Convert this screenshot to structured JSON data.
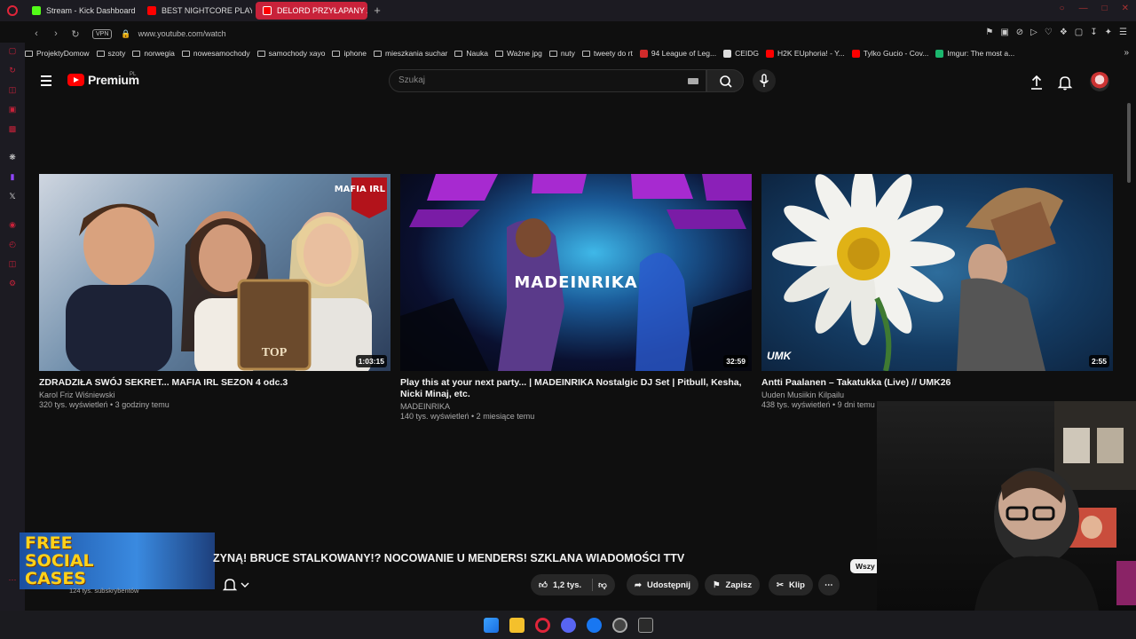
{
  "browser": {
    "tabs": [
      {
        "label": "Stream - Kick Dashboard",
        "favicon": "kick-icon",
        "active": false
      },
      {
        "label": "BEST NIGHTCORE PLAYLI",
        "favicon": "youtube-icon",
        "active": false
      },
      {
        "label": "DELORD PRZYŁAPANY Z",
        "favicon": "youtube-icon",
        "active": true
      }
    ],
    "new_tab": "+",
    "url": "www.youtube.com/watch",
    "vpn_label": "VPN",
    "accent_color": "#c8223a"
  },
  "bookmarks": [
    {
      "label": "ProjektyDomow",
      "type": "folder"
    },
    {
      "label": "szoty",
      "type": "folder"
    },
    {
      "label": "norwegia",
      "type": "folder"
    },
    {
      "label": "nowesamochody",
      "type": "folder"
    },
    {
      "label": "samochody xayo",
      "type": "folder"
    },
    {
      "label": "iphone",
      "type": "folder"
    },
    {
      "label": "mieszkania suchar",
      "type": "folder"
    },
    {
      "label": "Nauka",
      "type": "folder"
    },
    {
      "label": "Ważne jpg",
      "type": "folder"
    },
    {
      "label": "nuty",
      "type": "folder"
    },
    {
      "label": "tweety do rt",
      "type": "folder"
    },
    {
      "label": "94 League of Leg...",
      "type": "site",
      "color": "#d02b2b"
    },
    {
      "label": "CEIDG",
      "type": "site",
      "color": "#ddd"
    },
    {
      "label": "H2K EUphoria! - Y...",
      "type": "site",
      "color": "#ff0000"
    },
    {
      "label": "Tylko Gucio - Cov...",
      "type": "site",
      "color": "#ff0000"
    },
    {
      "label": "Imgur: The most a...",
      "type": "site",
      "color": "#1bb76e"
    }
  ],
  "youtube": {
    "brand": "Premium",
    "region": "PL",
    "search_placeholder": "Szukaj",
    "logo_color": "#ff0000"
  },
  "videos": [
    {
      "title": "ZDRADZIŁA SWÓJ SEKRET... MAFIA IRL SEZON 4 odc.3",
      "channel": "Karol Friz Wiśniewski",
      "meta": "320 tys. wyświetleń • 3 godziny temu",
      "duration": "1:03:15",
      "badge": "MAFIA IRL"
    },
    {
      "title": "Play this at your next party... | MADEINRIKA Nostalgic DJ Set | Pitbull, Kesha, Nicki Minaj, etc.",
      "channel": "MADEINRIKA",
      "meta": "140 tys. wyświetleń • 2 miesiące temu",
      "duration": "32:59",
      "overlay": "MADEINRIKA"
    },
    {
      "title": "Antti Paalanen – Takatukka (Live) // UMK26",
      "channel": "Uuden Musiikin Kilpailu",
      "meta": "438 tys. wyświetleń • 9 dni temu",
      "duration": "2:55",
      "badge": "UMK"
    }
  ],
  "now_playing": {
    "title": "ZYNĄ! BRUCE STALKOWANY!? NOCOWANIE U MENDERS! SZKLANA WIADOMOŚCI TTV",
    "subscribers": "124 tys. subskrybentów",
    "promo_text": "FREE SOCIAL CASES",
    "likes": "1,2 tys.",
    "share": "Udostępnij",
    "save": "Zapisz",
    "clip": "Klip",
    "chip": "Wszy"
  }
}
